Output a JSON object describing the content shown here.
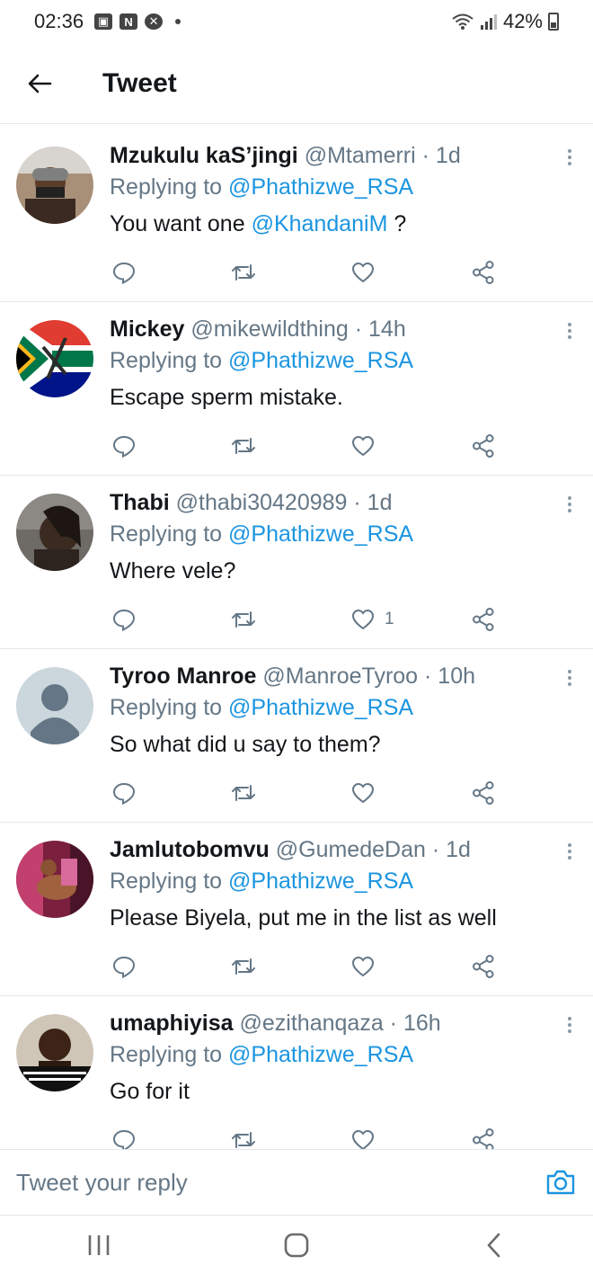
{
  "status_bar": {
    "time": "02:36",
    "battery": "42%"
  },
  "header": {
    "title": "Tweet"
  },
  "tweets": [
    {
      "name": "Mzukulu kaS’jingi",
      "handle": "@Mtamerri",
      "time": "1d",
      "replying_prefix": "Replying to",
      "replying_to": "@Phathizwe_RSA",
      "text_before": "You want one",
      "text_mention": "@KhandaniM",
      "text_after": " ?",
      "likes": ""
    },
    {
      "name": "Mickey",
      "handle": "@mikewildthing",
      "time": "14h",
      "replying_prefix": "Replying to",
      "replying_to": "@Phathizwe_RSA",
      "text_before": "Escape sperm mistake.",
      "text_mention": "",
      "text_after": "",
      "likes": ""
    },
    {
      "name": "Thabi",
      "handle": "@thabi30420989",
      "time": "1d",
      "replying_prefix": "Replying to",
      "replying_to": "@Phathizwe_RSA",
      "text_before": "Where vele?",
      "text_mention": "",
      "text_after": "",
      "likes": "1"
    },
    {
      "name": "Tyroo Manroe",
      "handle": "@ManroeTyroo",
      "time": "10h",
      "replying_prefix": "Replying to",
      "replying_to": "@Phathizwe_RSA",
      "text_before": "So what did u say to them?",
      "text_mention": "",
      "text_after": "",
      "likes": ""
    },
    {
      "name": "Jamlutobomvu",
      "handle": "@GumedeDan",
      "time": "1d",
      "replying_prefix": "Replying to",
      "replying_to": "@Phathizwe_RSA",
      "text_before": "Please Biyela, put me in the list as well",
      "text_mention": "",
      "text_after": "",
      "likes": ""
    },
    {
      "name": "umaphiyisa",
      "handle": "@ezithanqaza",
      "time": "16h",
      "replying_prefix": "Replying to",
      "replying_to": "@Phathizwe_RSA",
      "text_before": "Go for it",
      "text_mention": "",
      "text_after": "",
      "likes": ""
    }
  ],
  "reply": {
    "placeholder": "Tweet your reply"
  },
  "icons": {
    "back": "arrow-left-icon",
    "more": "more-vertical-icon",
    "reply": "comment-icon",
    "retweet": "retweet-icon",
    "like": "heart-icon",
    "share": "share-icon",
    "camera": "camera-icon",
    "nav_recents": "recents-icon",
    "nav_home": "home-icon",
    "nav_back": "chevron-left-icon"
  },
  "colors": {
    "accent": "#1b95e0",
    "secondary_text": "#657786",
    "divider": "#e1e8ed"
  }
}
